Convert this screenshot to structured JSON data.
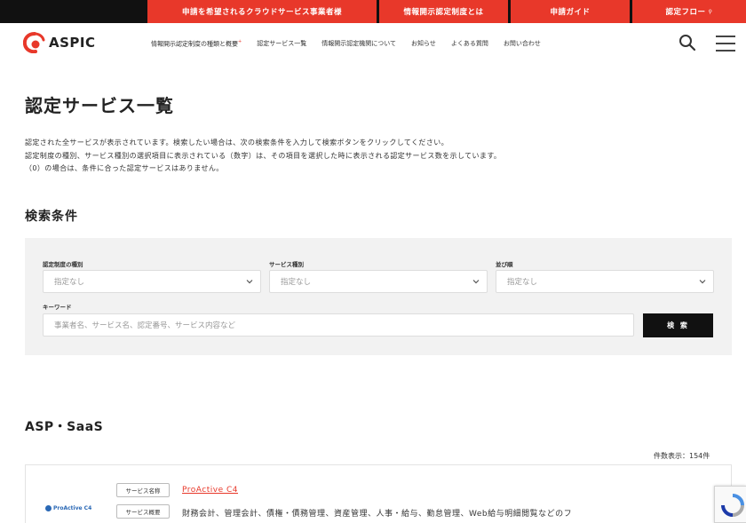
{
  "topbar": {
    "links": [
      {
        "label": "申請を希望されるクラウドサービス事業者様",
        "sup": ""
      },
      {
        "label": "情報開示認定制度とは",
        "sup": ""
      },
      {
        "label": "申請ガイド",
        "sup": ""
      },
      {
        "label": "認定フロー",
        "sup": "⚲"
      }
    ]
  },
  "header": {
    "logo_text": "ASPIC",
    "nav": [
      {
        "label": "情報開示認定制度の種類と概要",
        "sup": "+"
      },
      {
        "label": "認定サービス一覧",
        "sup": ""
      },
      {
        "label": "情報開示認定機関について",
        "sup": ""
      },
      {
        "label": "お知らせ",
        "sup": ""
      },
      {
        "label": "よくある質問",
        "sup": ""
      },
      {
        "label": "お問い合わせ",
        "sup": ""
      }
    ]
  },
  "page": {
    "title": "認定サービス一覧",
    "description": [
      "認定された全サービスが表示されています。検索したい場合は、次の検索条件を入力して検索ボタンをクリックしてください。",
      "認定制度の種別、サービス種別の選択項目に表示されている（数字）は、その項目を選択した時に表示される認定サービス数を示しています。",
      "（0）の場合は、条件に合った認定サービスはありません。"
    ]
  },
  "search": {
    "section_title": "検索条件",
    "fields": [
      {
        "label": "認定制度の種別",
        "value": "指定なし"
      },
      {
        "label": "サービス種別",
        "value": "指定なし"
      },
      {
        "label": "並び順",
        "value": "指定なし"
      }
    ],
    "keyword_label": "キーワード",
    "keyword_placeholder": "事業者名、サービス名、認定番号、サービス内容など",
    "submit_label": "検 索"
  },
  "results": {
    "category_title": "ASP・SaaS",
    "count_text": "件数表示：154件",
    "items": [
      {
        "logo_text": "ProActive C4",
        "name_tag": "サービス名称",
        "name": "ProActive C4",
        "summary_tag": "サービス概要",
        "summary": "財務会計、管理会計、債権・債務管理、資産管理、人事・給与、勤怠管理、Web給与明細閲覧などのフ"
      }
    ]
  },
  "colors": {
    "accent": "#e8382a",
    "topbar_bg": "#111111",
    "panel_bg": "#f2f2f2"
  }
}
